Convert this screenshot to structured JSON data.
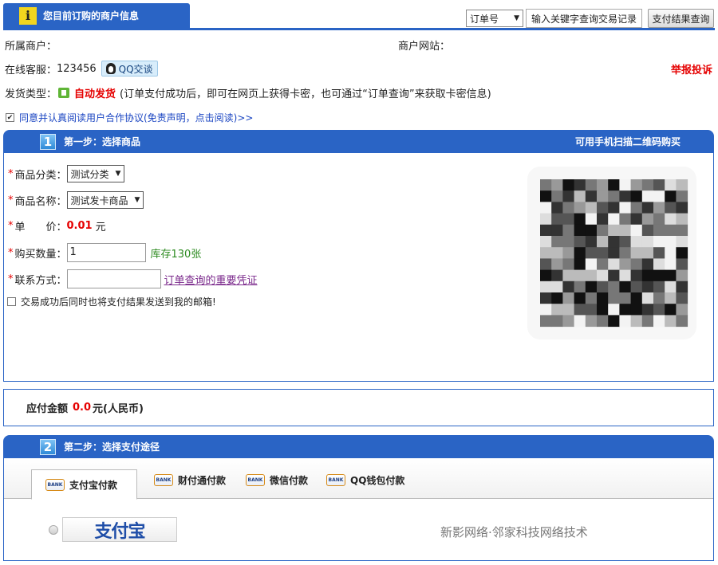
{
  "header": {
    "tab_icon": "i",
    "tab_title": "您目前订购的商户信息",
    "order_select": "订单号",
    "keyword_placeholder": "输入关键字查询交易记录",
    "result_button": "支付结果查询"
  },
  "merchant": {
    "owner_label": "所属商户：",
    "site_label": "商户网站：",
    "service_label": "在线客服：",
    "service_value": "123456",
    "qq_button": "QQ交谈",
    "report_link": "举报投诉",
    "delivery_label": "发货类型：",
    "delivery_value": "自动发货",
    "delivery_note": "(订单支付成功后，即可在网页上获得卡密，也可通过“订单查询”来获取卡密信息)",
    "agree_text": "同意并认真阅读用户合作协议(免责声明，点击阅读)>>"
  },
  "step1": {
    "num": "1",
    "title": "第一步：选择商品",
    "qr_hint": "可用手机扫描二维码购买",
    "category_label": "商品分类：",
    "category_value": "测试分类",
    "name_label": "商品名称：",
    "name_value": "测试发卡商品",
    "price_label": "单　　价：",
    "price_value": "0.01",
    "price_unit": "元",
    "qty_label": "购买数量：",
    "qty_value": "1",
    "stock": "库存130张",
    "contact_label": "联系方式：",
    "contact_link": "订单查询的重要凭证",
    "email_option": "交易成功后同时也将支付结果发送到我的邮箱!"
  },
  "amount": {
    "label": "应付金额",
    "value": "0.0",
    "unit": "元(人民币)"
  },
  "step2": {
    "num": "2",
    "title": "第二步：选择支付途径",
    "tabs": [
      "支付宝付款",
      "财付通付款",
      "微信付款",
      "QQ钱包付款"
    ],
    "bank_badge": "BANK",
    "alipay_logo": "支付宝",
    "footer_text": "新影网络·邻家科技网络技术"
  },
  "colors": {
    "primary": "#2a64c5",
    "accent_red": "#e50000",
    "stock_green": "#2b8a1f"
  }
}
